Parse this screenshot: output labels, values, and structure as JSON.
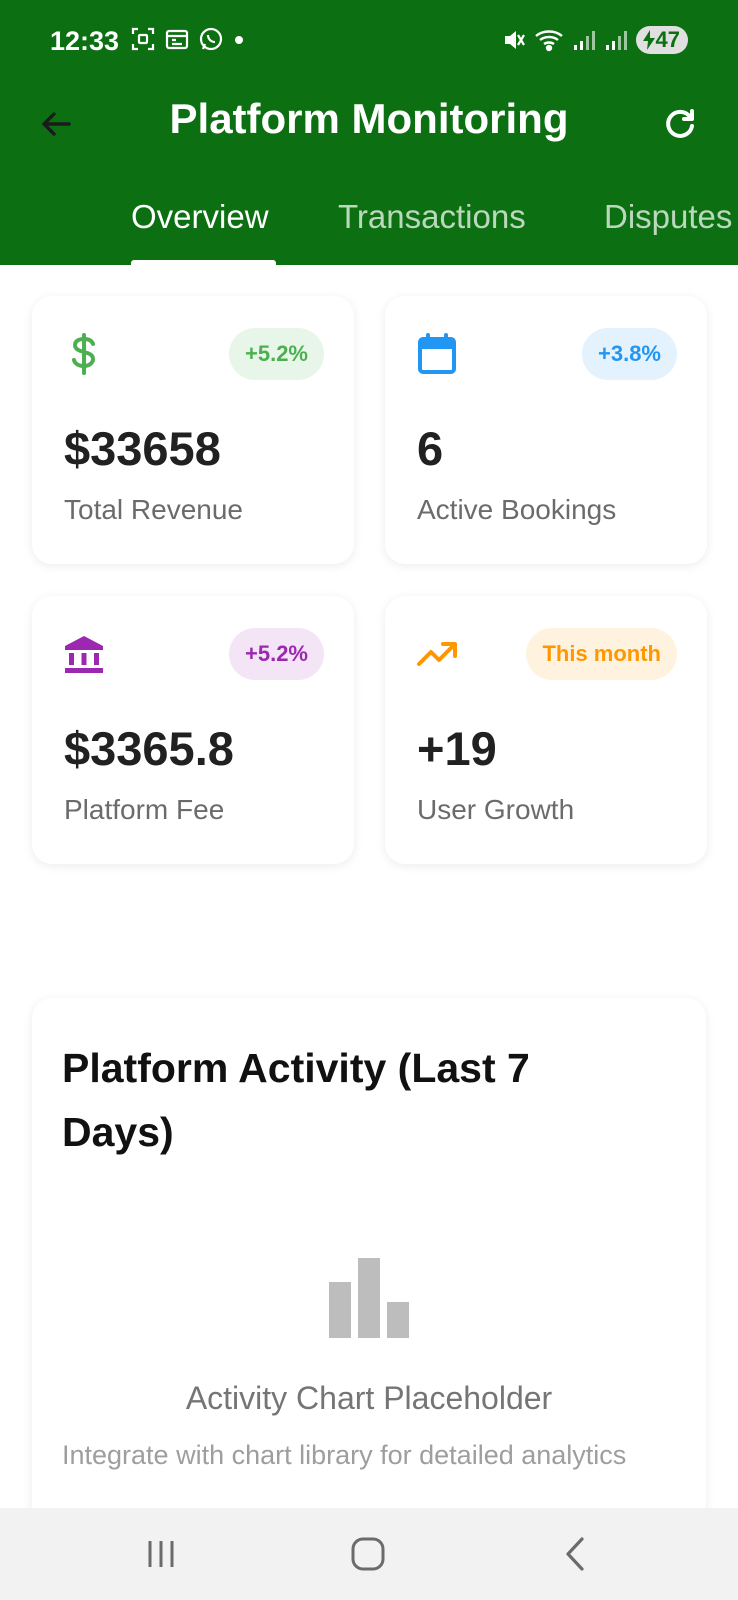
{
  "status_bar": {
    "time": "12:33",
    "battery": "47",
    "icons_left": [
      "screenshot-icon",
      "calendar-icon",
      "whatsapp-icon",
      "dot-icon"
    ],
    "icons_right": [
      "mute-icon",
      "wifi-icon",
      "signal-icon",
      "signal-icon",
      "battery-icon"
    ]
  },
  "header": {
    "title": "Platform Monitoring",
    "back_icon": "arrow-left-icon",
    "refresh_icon": "refresh-icon",
    "bg_color": "#0c7012"
  },
  "tabs": [
    {
      "label": "Overview",
      "active": true
    },
    {
      "label": "Transactions",
      "active": false
    },
    {
      "label": "Disputes",
      "active": false
    }
  ],
  "stats": [
    {
      "icon": "dollar-icon",
      "badge": "+5.2%",
      "value": "$33658",
      "label": "Total Revenue",
      "color": "#4caf50",
      "badge_bg": "#e8f5e9"
    },
    {
      "icon": "calendar-icon",
      "badge": "+3.8%",
      "value": "6",
      "label": "Active Bookings",
      "color": "#2196f3",
      "badge_bg": "#e3f2fd"
    },
    {
      "icon": "bank-icon",
      "badge": "+5.2%",
      "value": "$3365.8",
      "label": "Platform Fee",
      "color": "#9c27b0",
      "badge_bg": "#f3e5f5"
    },
    {
      "icon": "trending-up-icon",
      "badge": "This month",
      "value": "+19",
      "label": "User Growth",
      "color": "#ff9800",
      "badge_bg": "#fff3e0"
    }
  ],
  "activity": {
    "title": "Platform Activity (Last 7 Days)",
    "chart_icon": "bar-chart-icon",
    "placeholder_title": "Activity Chart Placeholder",
    "placeholder_subtitle": "Integrate with chart library for detailed analytics"
  },
  "nav_bar": {
    "icons": [
      "recent-apps-icon",
      "home-icon",
      "back-icon"
    ]
  }
}
